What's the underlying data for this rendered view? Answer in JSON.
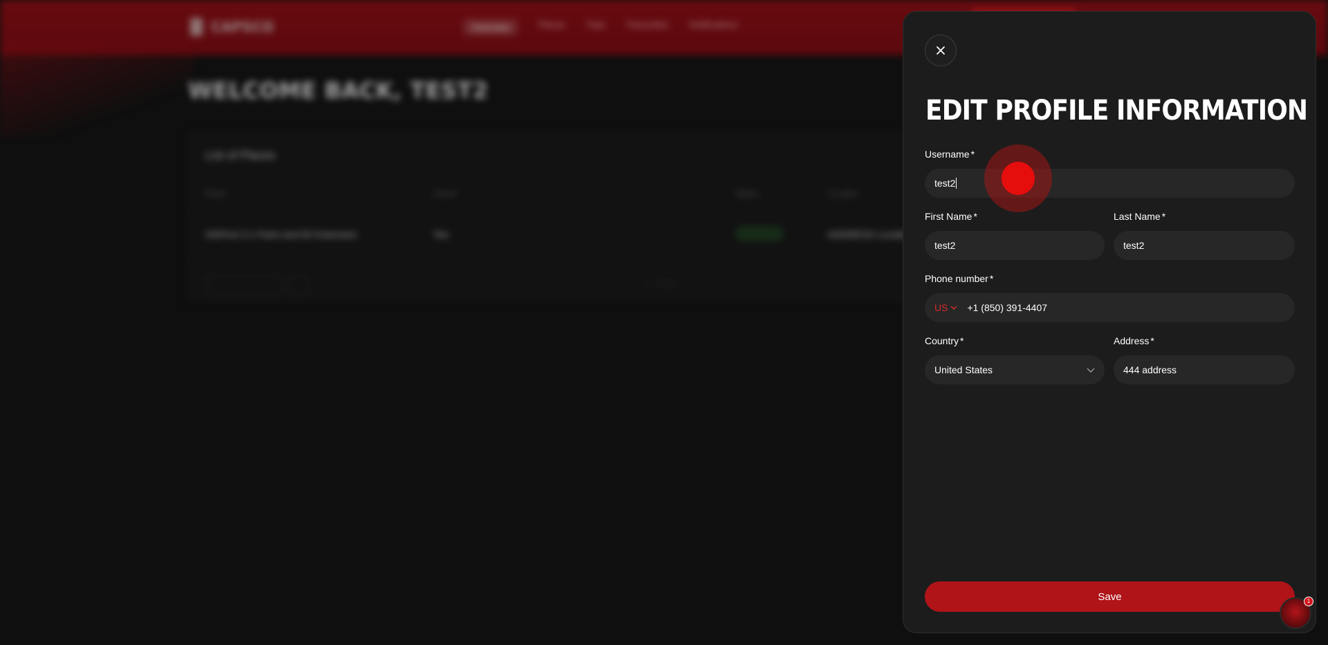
{
  "background": {
    "logo_text": "CAPSCO",
    "nav_items": [
      "Overview",
      "Places",
      "Trips",
      "Favourites",
      "Notifications"
    ],
    "welcome": "WELCOME BACK, TEST2",
    "card_title": "List of Places",
    "columns": [
      "Place",
      "Check",
      "Status",
      "Location"
    ],
    "row": {
      "place": "HDFirst 2:1 Parts and 60 Extension",
      "check": "Yes",
      "status": "Available",
      "location": "ADDRESS Location"
    },
    "pager_label": "10 items per page",
    "page_info": "1 - 1 of 1"
  },
  "modal": {
    "title": "EDIT PROFILE INFORMATION",
    "fields": {
      "username": {
        "label": "Username",
        "required": "*",
        "value": "test2"
      },
      "first_name": {
        "label": "First Name",
        "required": "*",
        "value": "test2"
      },
      "last_name": {
        "label": "Last Name",
        "required": "*",
        "value": "test2"
      },
      "phone": {
        "label": "Phone number",
        "required": "*",
        "country_code": "US",
        "value": "+1 (850) 391-4407"
      },
      "country": {
        "label": "Country",
        "required": "*",
        "value": "United States"
      },
      "address": {
        "label": "Address",
        "required": "*",
        "value": "444 address"
      }
    },
    "save_label": "Save"
  },
  "help_widget": {
    "badge_count": "1"
  },
  "colors": {
    "accent": "#b01419",
    "panel_bg": "#1c1c1c",
    "input_bg": "#272727",
    "header_red": "#8a0f14"
  },
  "icons": {
    "close": "close-icon",
    "select": "chevron-down-icon",
    "help": "help-widget-icon"
  }
}
